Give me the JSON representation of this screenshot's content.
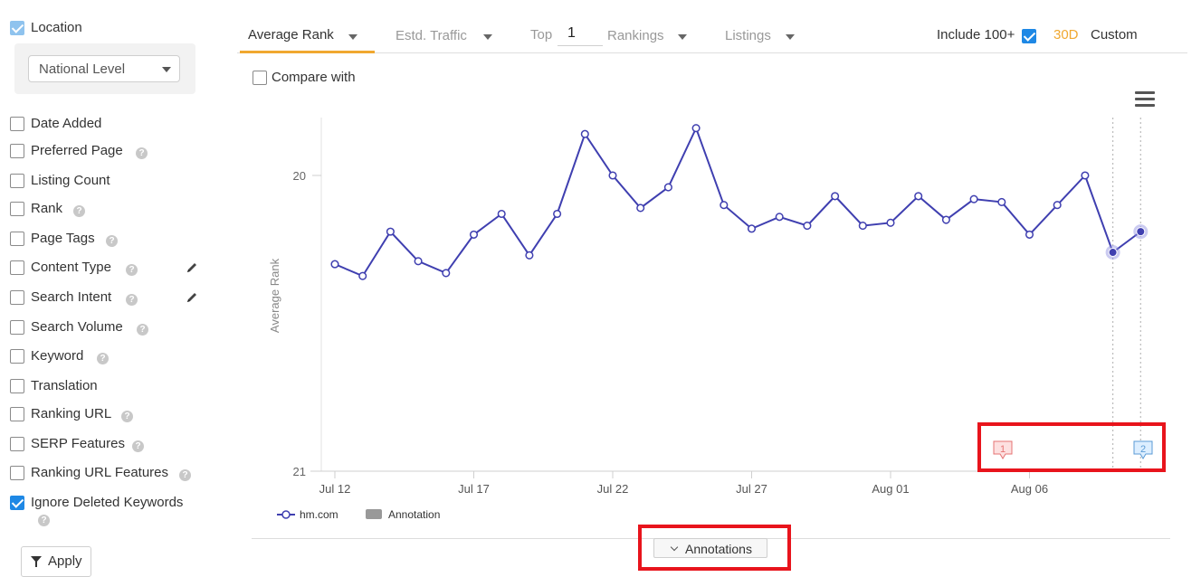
{
  "sidebar": {
    "location": {
      "label": "Location",
      "checked": true
    },
    "level_select": {
      "value": "National Level"
    },
    "filters": [
      {
        "label": "Date Added",
        "checked": false,
        "help": false,
        "edit": false
      },
      {
        "label": "Preferred Page",
        "checked": false,
        "help": true,
        "edit": false
      },
      {
        "label": "Listing Count",
        "checked": false,
        "help": false,
        "edit": false
      },
      {
        "label": "Rank",
        "checked": false,
        "help": true,
        "edit": false
      },
      {
        "label": "Page Tags",
        "checked": false,
        "help": true,
        "edit": false
      },
      {
        "label": "Content Type",
        "checked": false,
        "help": true,
        "edit": true
      },
      {
        "label": "Search Intent",
        "checked": false,
        "help": true,
        "edit": true
      },
      {
        "label": "Search Volume",
        "checked": false,
        "help": true,
        "edit": false
      },
      {
        "label": "Keyword",
        "checked": false,
        "help": true,
        "edit": false
      },
      {
        "label": "Translation",
        "checked": false,
        "help": false,
        "edit": false
      },
      {
        "label": "Ranking URL",
        "checked": false,
        "help": true,
        "edit": false
      },
      {
        "label": "SERP Features",
        "checked": false,
        "help": true,
        "edit": false
      },
      {
        "label": "Ranking URL Features",
        "checked": false,
        "help": true,
        "edit": false
      },
      {
        "label": "Ignore Deleted Keywords",
        "checked": true,
        "help": true,
        "edit": false
      }
    ],
    "apply_label": "Apply"
  },
  "topbar": {
    "tabs": [
      {
        "label": "Average Rank",
        "active": true
      },
      {
        "label": "Estd. Traffic",
        "active": false
      },
      {
        "label": "Rankings",
        "active": false
      },
      {
        "label": "Listings",
        "active": false
      }
    ],
    "top_label": "Top",
    "top_value": "1",
    "include_label": "Include 100+",
    "include_checked": true,
    "range_30d": "30D",
    "range_custom": "Custom",
    "accent": "#f0a830"
  },
  "compare": {
    "label": "Compare with",
    "checked": false
  },
  "menu_icon": "hamburger-menu-icon",
  "annotations_button": {
    "label": "Annotations"
  },
  "chart_data": {
    "type": "line",
    "title": "",
    "xlabel": "",
    "ylabel": "Average Rank",
    "y_reversed": true,
    "ylim": [
      20.0,
      21.0
    ],
    "y_ticks": [
      20,
      21
    ],
    "x_ticks": [
      "Jul 12",
      "Jul 17",
      "Jul 22",
      "Jul 27",
      "Aug 01",
      "Aug 06"
    ],
    "x": [
      "Jul 12",
      "Jul 13",
      "Jul 14",
      "Jul 15",
      "Jul 16",
      "Jul 17",
      "Jul 18",
      "Jul 19",
      "Jul 20",
      "Jul 21",
      "Jul 22",
      "Jul 23",
      "Jul 24",
      "Jul 25",
      "Jul 26",
      "Jul 27",
      "Jul 28",
      "Jul 29",
      "Jul 30",
      "Jul 31",
      "Aug 01",
      "Aug 02",
      "Aug 03",
      "Aug 04",
      "Aug 05",
      "Aug 06",
      "Aug 07",
      "Aug 08",
      "Aug 09",
      "Aug 10"
    ],
    "series": [
      {
        "name": "hm.com",
        "color": "#3f3fb0",
        "values": [
          20.3,
          20.34,
          20.19,
          20.29,
          20.33,
          20.2,
          20.13,
          20.27,
          20.13,
          19.86,
          20.0,
          20.11,
          20.04,
          19.84,
          20.1,
          20.18,
          20.14,
          20.17,
          20.07,
          20.17,
          20.16,
          20.07,
          20.15,
          20.08,
          20.09,
          20.2,
          20.1,
          20.0,
          20.26,
          20.19
        ]
      }
    ],
    "legend": [
      {
        "label": "hm.com",
        "kind": "line"
      },
      {
        "label": "Annotation",
        "kind": "box"
      }
    ],
    "annotations": [
      {
        "label": "1",
        "x": "Aug 09",
        "color": "#e57373"
      },
      {
        "label": "2",
        "x": "Aug 10",
        "color": "#5b9bd5"
      }
    ],
    "grid": false,
    "legend_position": "bottom-left"
  }
}
